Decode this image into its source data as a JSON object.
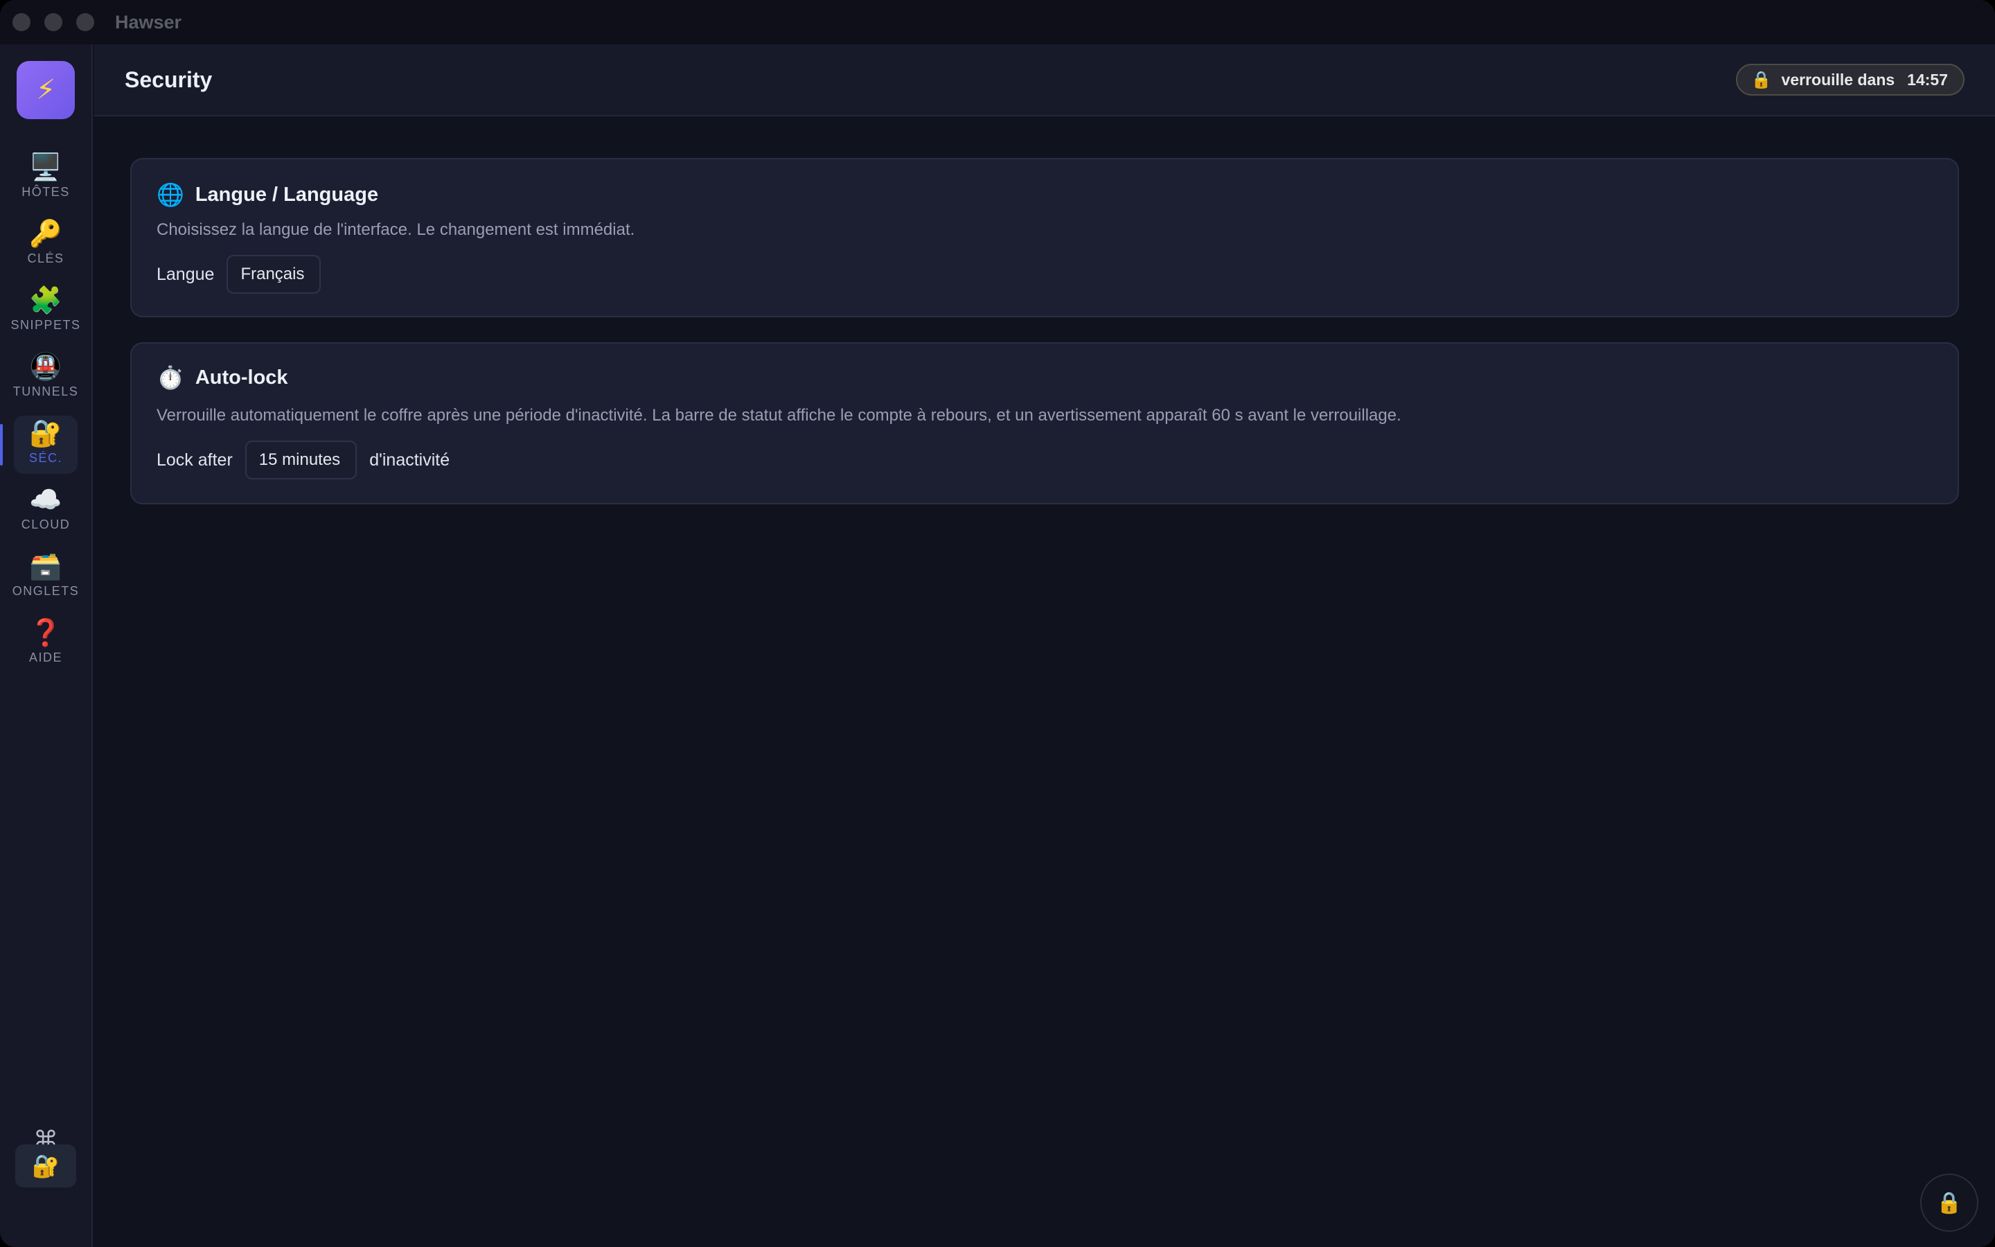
{
  "window": {
    "app_title": "Hawser"
  },
  "sidebar": {
    "logo_icon": "lightning-icon",
    "items": [
      {
        "id": "hotes",
        "label": "HÔTES",
        "icon": "desktop-computer-icon",
        "glyph": "🖥️"
      },
      {
        "id": "cles",
        "label": "CLÉS",
        "icon": "key-icon",
        "glyph": "🔑"
      },
      {
        "id": "snippets",
        "label": "SNIPPETS",
        "icon": "puzzle-piece-icon",
        "glyph": "🧩"
      },
      {
        "id": "tunnels",
        "label": "TUNNELS",
        "icon": "train-icon",
        "glyph": "🚇"
      },
      {
        "id": "securite",
        "label": "SÉC.",
        "icon": "lock-with-key-icon",
        "glyph": "🔐",
        "active": true
      },
      {
        "id": "cloud",
        "label": "CLOUD",
        "icon": "cloud-icon",
        "glyph": "☁️"
      },
      {
        "id": "onglets",
        "label": "ONGLETS",
        "icon": "card-file-box-icon",
        "glyph": "🗃️"
      },
      {
        "id": "aide",
        "label": "AIDE",
        "icon": "question-mark-icon",
        "glyph": "❓"
      }
    ],
    "command_palette": {
      "glyph": "⌘",
      "label": "⌘K"
    },
    "lock_button_icon": "lock-with-key-icon"
  },
  "header": {
    "title": "Security",
    "lock_status": {
      "text": "verrouille dans",
      "countdown": "14:57",
      "icon": "padlock-icon"
    }
  },
  "cards": {
    "language": {
      "icon": "globe-icon",
      "title": "Langue / Language",
      "description": "Choisissez la langue de l'interface. Le changement est immédiat.",
      "field_label": "Langue",
      "selected_value": "Français"
    },
    "autolock": {
      "icon": "stopwatch-icon",
      "title": "Auto-lock",
      "description": "Verrouille automatiquement le coffre après une période d'inactivité. La barre de statut affiche le compte à rebours, et un avertissement apparaît 60 s avant le verrouillage.",
      "field_label": "Lock after",
      "selected_value": "15 minutes",
      "suffix": "d'inactivité"
    }
  },
  "floating_lock": {
    "icon": "padlock-icon"
  },
  "colors": {
    "background": "#10121d",
    "sidebar": "#161827",
    "card": "#1c1f31",
    "accent": "#5166e8",
    "logo_gradient_start": "#8f6cf4",
    "logo_gradient_end": "#6f58e8"
  }
}
